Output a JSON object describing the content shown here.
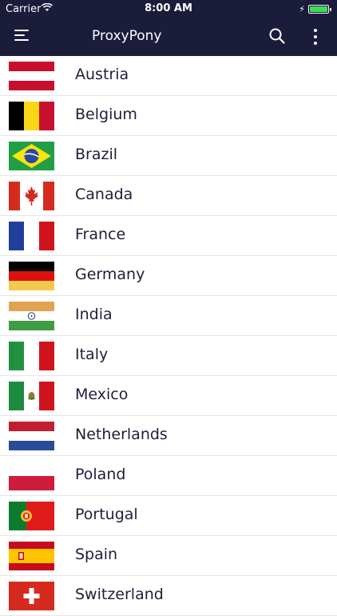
{
  "status_bar": {
    "carrier": "Carrier",
    "time": "8:00 AM",
    "battery_percent": 100
  },
  "app_bar": {
    "title": "ProxyPony",
    "menu_icon": "hamburger-menu-icon",
    "search_icon": "search-icon",
    "more_icon": "more-vertical-icon"
  },
  "colors": {
    "header_bg": "#1b1b3a",
    "text": "#1e1e3c",
    "divider": "#e5e5e9"
  },
  "countries": [
    {
      "name": "Austria",
      "flag": "austria-flag-icon"
    },
    {
      "name": "Belgium",
      "flag": "belgium-flag-icon"
    },
    {
      "name": "Brazil",
      "flag": "brazil-flag-icon"
    },
    {
      "name": "Canada",
      "flag": "canada-flag-icon"
    },
    {
      "name": "France",
      "flag": "france-flag-icon"
    },
    {
      "name": "Germany",
      "flag": "germany-flag-icon"
    },
    {
      "name": "India",
      "flag": "india-flag-icon"
    },
    {
      "name": "Italy",
      "flag": "italy-flag-icon"
    },
    {
      "name": "Mexico",
      "flag": "mexico-flag-icon"
    },
    {
      "name": "Netherlands",
      "flag": "netherlands-flag-icon"
    },
    {
      "name": "Poland",
      "flag": "poland-flag-icon"
    },
    {
      "name": "Portugal",
      "flag": "portugal-flag-icon"
    },
    {
      "name": "Spain",
      "flag": "spain-flag-icon"
    },
    {
      "name": "Switzerland",
      "flag": "switzerland-flag-icon"
    }
  ]
}
